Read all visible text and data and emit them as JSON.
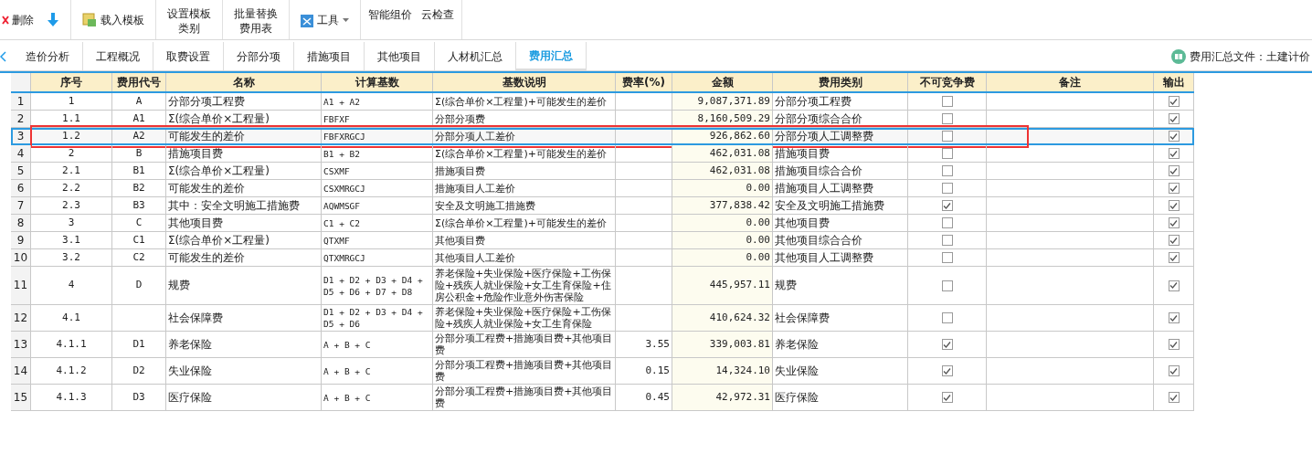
{
  "toolbar": {
    "small_buttons": [
      {
        "label": "删除",
        "kind": "delete"
      },
      {
        "label": "载入模板",
        "kind": "load"
      }
    ],
    "large_buttons": [
      {
        "label": "设置模板",
        "label2": "类别"
      },
      {
        "label": "批量替换",
        "label2": "费用表"
      }
    ],
    "tools": {
      "label": "工具"
    },
    "ai_buttons": [
      {
        "label": "智能组价"
      },
      {
        "label": "云检查"
      }
    ]
  },
  "tabs": [
    {
      "label": "造价分析",
      "selected": false
    },
    {
      "label": "工程概况",
      "selected": false
    },
    {
      "label": "取费设置",
      "selected": false
    },
    {
      "label": "分部分项",
      "selected": false
    },
    {
      "label": "措施项目",
      "selected": false
    },
    {
      "label": "其他项目",
      "selected": false
    },
    {
      "label": "人材机汇总",
      "selected": false
    },
    {
      "label": "费用汇总",
      "selected": true
    }
  ],
  "file_label": "费用汇总文件：土建计价",
  "table": {
    "columns": [
      "序号",
      "费用代号",
      "名称",
      "计算基数",
      "基数说明",
      "费率(%)",
      "金额",
      "费用类别",
      "不可竞争费",
      "备注",
      "输出"
    ],
    "rows": [
      {
        "n": "1",
        "seq": "1",
        "code": "A",
        "name": "分部分项工程费",
        "base": "A1 + A2",
        "desc": "Σ(综合单价×工程量)+可能发生的差价",
        "rate": "",
        "amount": "9,087,371.89",
        "category": "分部分项工程费",
        "noncompetitive": false,
        "output": true,
        "selected": false,
        "annotated": false
      },
      {
        "n": "2",
        "seq": "1.1",
        "code": "A1",
        "name": "Σ(综合单价×工程量)",
        "base": "FBFXF",
        "desc": "分部分项费",
        "rate": "",
        "amount": "8,160,509.29",
        "category": "分部分项综合合价",
        "noncompetitive": false,
        "output": true,
        "selected": false,
        "annotated": false
      },
      {
        "n": "3",
        "seq": "1.2",
        "code": "A2",
        "name": "可能发生的差价",
        "base": "FBFXRGCJ",
        "desc": "分部分项人工差价",
        "rate": "",
        "amount": "926,862.60",
        "category": "分部分项人工调整费",
        "noncompetitive": false,
        "output": true,
        "selected": true,
        "annotated": true
      },
      {
        "n": "4",
        "seq": "2",
        "code": "B",
        "name": "措施项目费",
        "base": "B1 + B2",
        "desc": "Σ(综合单价×工程量)+可能发生的差价",
        "rate": "",
        "amount": "462,031.08",
        "category": "措施项目费",
        "noncompetitive": false,
        "output": true,
        "selected": false,
        "annotated": false
      },
      {
        "n": "5",
        "seq": "2.1",
        "code": "B1",
        "name": "Σ(综合单价×工程量)",
        "base": "CSXMF",
        "desc": "措施项目费",
        "rate": "",
        "amount": "462,031.08",
        "category": "措施项目综合合价",
        "noncompetitive": false,
        "output": true,
        "selected": false,
        "annotated": false
      },
      {
        "n": "6",
        "seq": "2.2",
        "code": "B2",
        "name": "可能发生的差价",
        "base": "CSXMRGCJ",
        "desc": "措施项目人工差价",
        "rate": "",
        "amount": "0.00",
        "category": "措施项目人工调整费",
        "noncompetitive": false,
        "output": true,
        "selected": false,
        "annotated": false
      },
      {
        "n": "7",
        "seq": "2.3",
        "code": "B3",
        "name": "其中：安全文明施工措施费",
        "base": "AQWMSGF",
        "desc": "安全及文明施工措施费",
        "rate": "",
        "amount": "377,838.42",
        "category": "安全及文明施工措施费",
        "noncompetitive": true,
        "output": true,
        "selected": false,
        "annotated": false
      },
      {
        "n": "8",
        "seq": "3",
        "code": "C",
        "name": "其他项目费",
        "base": "C1 + C2",
        "desc": "Σ(综合单价×工程量)+可能发生的差价",
        "rate": "",
        "amount": "0.00",
        "category": "其他项目费",
        "noncompetitive": false,
        "output": true,
        "selected": false,
        "annotated": false
      },
      {
        "n": "9",
        "seq": "3.1",
        "code": "C1",
        "name": "Σ(综合单价×工程量)",
        "base": "QTXMF",
        "desc": "其他项目费",
        "rate": "",
        "amount": "0.00",
        "category": "其他项目综合合价",
        "noncompetitive": false,
        "output": true,
        "selected": false,
        "annotated": false
      },
      {
        "n": "10",
        "seq": "3.2",
        "code": "C2",
        "name": "可能发生的差价",
        "base": "QTXMRGCJ",
        "desc": "其他项目人工差价",
        "rate": "",
        "amount": "0.00",
        "category": "其他项目人工调整费",
        "noncompetitive": false,
        "output": true,
        "selected": false,
        "annotated": false
      },
      {
        "n": "11",
        "seq": "4",
        "code": "D",
        "name": "规费",
        "base": "D1 + D2 + D3 + D4 + D5 + D6 + D7 + D8",
        "desc": "养老保险+失业保险+医疗保险+工伤保险+残疾人就业保险+女工生育保险+住房公积金+危险作业意外伤害保险",
        "rate": "",
        "amount": "445,957.11",
        "category": "规费",
        "noncompetitive": false,
        "output": true,
        "selected": false,
        "annotated": false
      },
      {
        "n": "12",
        "seq": "4.1",
        "code": "",
        "name": "社会保障费",
        "base": "D1 + D2 + D3 + D4 + D5 + D6",
        "desc": "养老保险+失业保险+医疗保险+工伤保险+残疾人就业保险+女工生育保险",
        "rate": "",
        "amount": "410,624.32",
        "category": "社会保障费",
        "noncompetitive": false,
        "output": true,
        "selected": false,
        "annotated": false
      },
      {
        "n": "13",
        "seq": "4.1.1",
        "code": "D1",
        "name": "养老保险",
        "base": "A + B + C",
        "desc": "分部分项工程费+措施项目费+其他项目费",
        "rate": "3.55",
        "amount": "339,003.81",
        "category": "养老保险",
        "noncompetitive": true,
        "output": true,
        "selected": false,
        "annotated": false
      },
      {
        "n": "14",
        "seq": "4.1.2",
        "code": "D2",
        "name": "失业保险",
        "base": "A + B + C",
        "desc": "分部分项工程费+措施项目费+其他项目费",
        "rate": "0.15",
        "amount": "14,324.10",
        "category": "失业保险",
        "noncompetitive": true,
        "output": true,
        "selected": false,
        "annotated": false
      },
      {
        "n": "15",
        "seq": "4.1.3",
        "code": "D3",
        "name": "医疗保险",
        "base": "A + B + C",
        "desc": "分部分项工程费+措施项目费+其他项目费",
        "rate": "0.45",
        "amount": "42,972.31",
        "category": "医疗保险",
        "noncompetitive": true,
        "output": true,
        "selected": false,
        "annotated": false
      }
    ]
  }
}
